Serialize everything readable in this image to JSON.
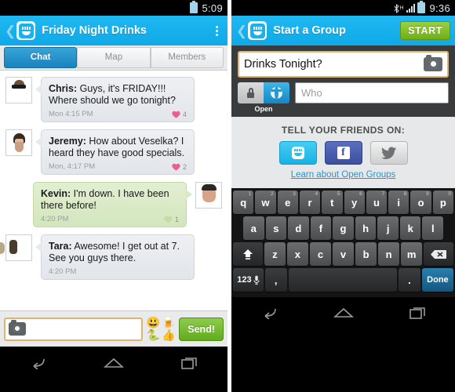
{
  "left_phone": {
    "status": {
      "time": "5:09",
      "icons": [
        "battery-icon"
      ]
    },
    "actionbar": {
      "title": "Friday Night Drinks",
      "logo": "app-logo-icon",
      "overflow": "overflow-menu-icon",
      "back": "back-chevron-icon"
    },
    "tabs": [
      {
        "label": "Chat",
        "active": true
      },
      {
        "label": "Map",
        "active": false
      },
      {
        "label": "Members",
        "active": false
      }
    ],
    "messages": [
      {
        "sender": "Chris:",
        "text": " Guys, it's FRIDAY!!! Where should we go tonight?",
        "time": "Mon 4:15 PM",
        "reaction_count": "4",
        "side": "them",
        "avatar": "avatar-chris"
      },
      {
        "sender": "Jeremy:",
        "text": " How about Veselka? I heard they have good specials.",
        "time": "Mon, 4:17 PM",
        "reaction_count": "2",
        "side": "them",
        "avatar": "avatar-jeremy"
      },
      {
        "sender": "Kevin:",
        "text": " I'm down. I have been there before!",
        "time": "4:20 PM",
        "reaction_count": "1",
        "side": "mine",
        "avatar": "avatar-kevin"
      },
      {
        "sender": "Tara:",
        "text": " Awesome! I get out at 7. See you guys there.",
        "time": "4:20 PM",
        "reaction_count": "",
        "side": "them",
        "avatar": "avatar-tara"
      }
    ],
    "composer": {
      "camera_icon": "camera-icon",
      "input_value": "",
      "input_placeholder": "",
      "emoji": [
        "😃",
        "🍺",
        "🐍",
        "👍"
      ],
      "send_label": "Send!"
    },
    "navbar": [
      "back-nav-icon",
      "home-nav-icon",
      "recents-nav-icon"
    ]
  },
  "right_phone": {
    "status": {
      "time": "9:36",
      "icons": [
        "bluetooth-icon",
        "signal-h-icon",
        "battery-icon"
      ],
      "network": "H"
    },
    "actionbar": {
      "title": "Start a Group",
      "start_label": "START",
      "logo": "app-logo-icon",
      "back": "back-chevron-icon"
    },
    "form": {
      "group_name_value": "Drinks Tonight?",
      "camera_icon": "camera-icon",
      "privacy_toggle": {
        "options": [
          "lock-icon",
          "globe-icon"
        ],
        "selected": "globe-icon",
        "label": "Open"
      },
      "who_placeholder": "Who",
      "who_value": ""
    },
    "share": {
      "heading": "TELL YOUR FRIENDS ON:",
      "buttons": [
        "app-share-icon",
        "facebook-icon",
        "twitter-icon"
      ],
      "link": "Learn about Open Groups"
    },
    "keyboard": {
      "row1": [
        {
          "k": "q",
          "n": "1"
        },
        {
          "k": "w",
          "n": "2"
        },
        {
          "k": "e",
          "n": "3"
        },
        {
          "k": "r",
          "n": "4"
        },
        {
          "k": "t",
          "n": "5"
        },
        {
          "k": "y",
          "n": "6"
        },
        {
          "k": "u",
          "n": "7"
        },
        {
          "k": "i",
          "n": "8"
        },
        {
          "k": "o",
          "n": "9"
        },
        {
          "k": "p",
          "n": "0"
        }
      ],
      "row2": [
        {
          "k": "a"
        },
        {
          "k": "s"
        },
        {
          "k": "d"
        },
        {
          "k": "f"
        },
        {
          "k": "g"
        },
        {
          "k": "h"
        },
        {
          "k": "j"
        },
        {
          "k": "k"
        },
        {
          "k": "l"
        }
      ],
      "row3": [
        {
          "k": "shift-key"
        },
        {
          "k": "z"
        },
        {
          "k": "x"
        },
        {
          "k": "c"
        },
        {
          "k": "v"
        },
        {
          "k": "b"
        },
        {
          "k": "n"
        },
        {
          "k": "m"
        },
        {
          "k": "backspace-key"
        }
      ],
      "row4": [
        {
          "k": "123",
          "mic": true
        },
        {
          "k": ","
        },
        {
          "k": "space"
        },
        {
          "k": "."
        },
        {
          "k": "Done"
        }
      ],
      "numeric_label": "123",
      "comma_label": ",",
      "period_label": ".",
      "done_label": "Done"
    },
    "navbar": [
      "back-nav-icon",
      "home-nav-icon",
      "recents-nav-icon"
    ]
  },
  "colors": {
    "brand_blue": "#19b2ef",
    "tab_active": "#1b82bd",
    "send_green": "#63ab1e",
    "field_border": "#e2b273",
    "heart_pink": "#e8608f",
    "link_blue": "#2f93c9",
    "done_blue": "#1b6d9c"
  }
}
